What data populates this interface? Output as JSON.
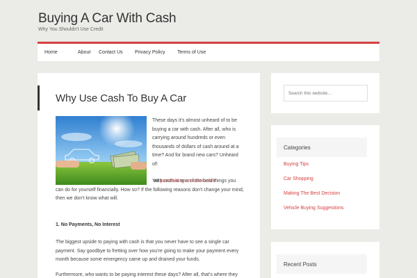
{
  "site": {
    "title": "Buying A Car With Cash",
    "description": "Why You Shouldn't Use Credit"
  },
  "nav": {
    "items": [
      "Home",
      "About",
      "Contact Us",
      "Privacy Policy",
      "Terms of Use"
    ]
  },
  "article": {
    "title": "Why Use Cash To Buy A Car",
    "intro_paragraph": "These days it's almost unheard of to be buying a car with cash. After all, who is carrying around hundreds or even thousands of dollars of cash around at a time? And for brand new cars? Unheard of!",
    "para2_prefix": "Yet ",
    "para2_link": "purchasing an automobile",
    "para2_suffix": " with cash is one of the best things you can do for yourself financially. How so? If the following reasons don't change your mind, then we don't know what will.",
    "heading1": "1. No Payments, No Interest",
    "para3": "The biggest upside to paying with cash is that you never have to see a single car payment. Say goodbye to fretting over how you're going to make your payment every month because some emergency came up and drained your funds.",
    "para4": "Furthermore, who wants to be paying interest these days? After all, that's where they"
  },
  "sidebar": {
    "search_placeholder": "Search this website…",
    "categories_title": "Categories",
    "categories": [
      "Buying Tips",
      "Car Shopping",
      "Making The Best Decision",
      "Vehicle Buying Suggestions"
    ],
    "recent_posts_title": "Recent Posts"
  },
  "colors": {
    "accent": "#d53f3f",
    "background": "#ebebe8"
  }
}
